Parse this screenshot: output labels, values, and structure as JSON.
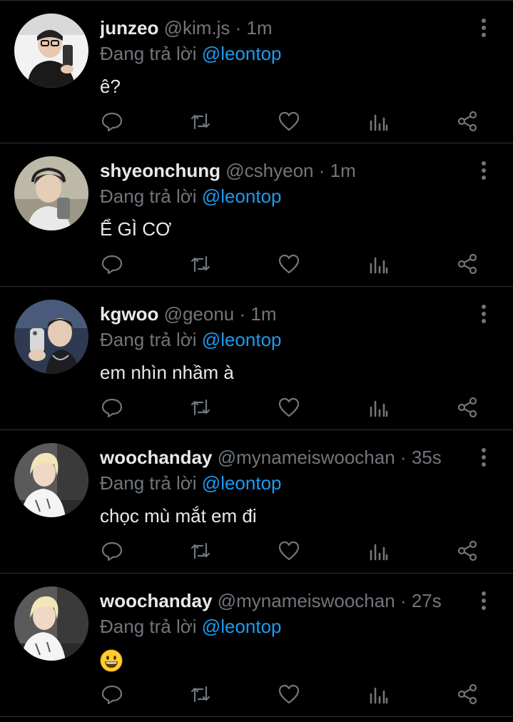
{
  "colors": {
    "background": "#000000",
    "primary_text": "#e7e9ea",
    "secondary_text": "#71767b",
    "accent": "#1d9bf0",
    "divider": "#2f3336"
  },
  "icons": {
    "reply": "comment-icon",
    "retweet": "retweet-icon",
    "like": "heart-icon",
    "views": "analytics-icon",
    "share": "share-icon",
    "more": "more-vertical-icon"
  },
  "tweets": [
    {
      "name": "junzeo",
      "handle": "@kim.js",
      "separator": "·",
      "time": "1m",
      "reply_prefix": "Đang trả lời",
      "reply_to": "@leontop",
      "text": "ê?"
    },
    {
      "name": "shyeonchung",
      "handle": "@cshyeon",
      "separator": "·",
      "time": "1m",
      "reply_prefix": "Đang trả lời",
      "reply_to": "@leontop",
      "text": "Ể GÌ CƠ"
    },
    {
      "name": "kgwoo",
      "handle": "@geonu",
      "separator": "·",
      "time": "1m",
      "reply_prefix": "Đang trả lời",
      "reply_to": "@leontop",
      "text": "em nhìn nhầm à"
    },
    {
      "name": "woochanday",
      "handle": "@mynameiswoochan",
      "separator": "·",
      "time": "35s",
      "reply_prefix": "Đang trả lời",
      "reply_to": "@leontop",
      "text": "chọc mù mắt em đi"
    },
    {
      "name": "woochanday",
      "handle": "@mynameiswoochan",
      "separator": "·",
      "time": "27s",
      "reply_prefix": "Đang trả lời",
      "reply_to": "@leontop",
      "text": "",
      "emoji": "grinning-face-emoji"
    }
  ]
}
